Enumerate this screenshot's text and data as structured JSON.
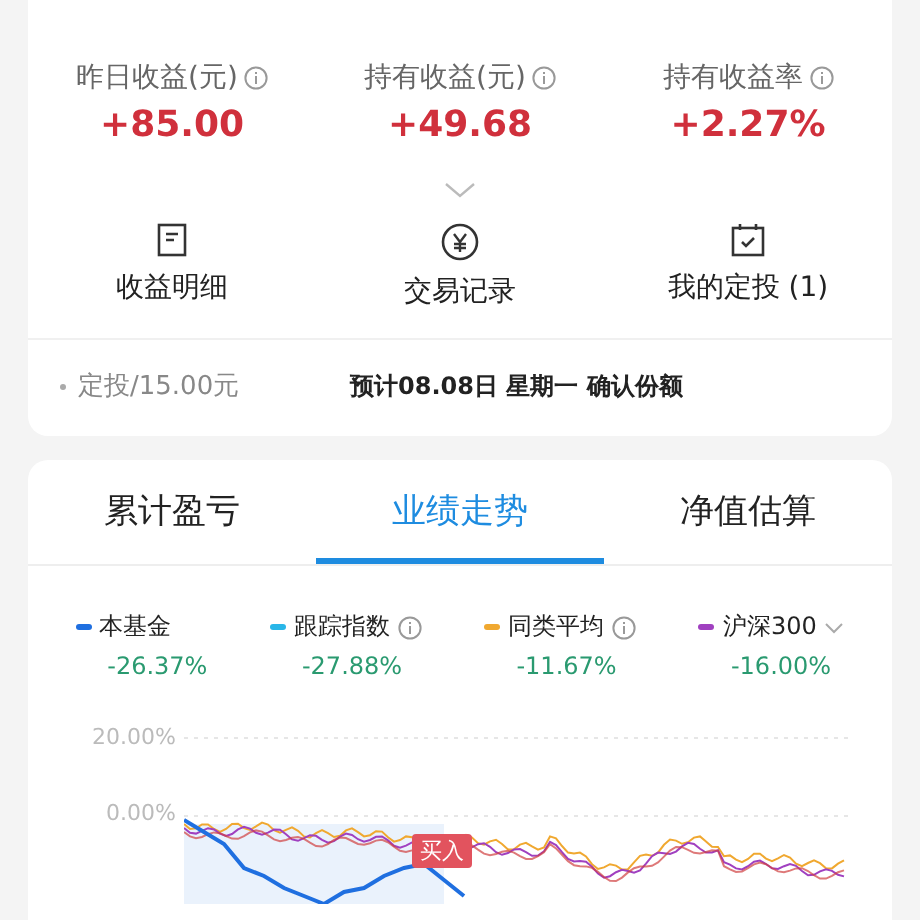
{
  "stats": [
    {
      "label": "昨日收益(元)",
      "value": "+85.00",
      "info": true
    },
    {
      "label": "持有收益(元)",
      "value": "+49.68",
      "info": true
    },
    {
      "label": "持有收益率",
      "value": "+2.27%",
      "info": true
    }
  ],
  "actions": [
    {
      "kind": "detail",
      "label": "收益明细"
    },
    {
      "kind": "trade",
      "label": "交易记录"
    },
    {
      "kind": "plan",
      "label": "我的定投 (1)"
    }
  ],
  "plan": {
    "left": "定投/15.00元",
    "right": "预计08.08日 星期一 确认份额"
  },
  "tabs": [
    {
      "label": "累计盈亏",
      "selected": false
    },
    {
      "label": "业绩走势",
      "selected": true
    },
    {
      "label": "净值估算",
      "selected": false
    }
  ],
  "legend": [
    {
      "name": "本基金",
      "value": "-26.37%",
      "color": "#1f6fe0",
      "info": false,
      "dropdown": false
    },
    {
      "name": "跟踪指数",
      "value": "-27.88%",
      "color": "#29b6e8",
      "info": true,
      "dropdown": false
    },
    {
      "name": "同类平均",
      "value": "-11.67%",
      "color": "#f0a830",
      "info": true,
      "dropdown": false
    },
    {
      "name": "沪深300",
      "value": "-16.00%",
      "color": "#a040c0",
      "info": false,
      "dropdown": true
    }
  ],
  "chart": {
    "y_labels": [
      "20.00%",
      "0.00%"
    ],
    "marker": "买入"
  }
}
